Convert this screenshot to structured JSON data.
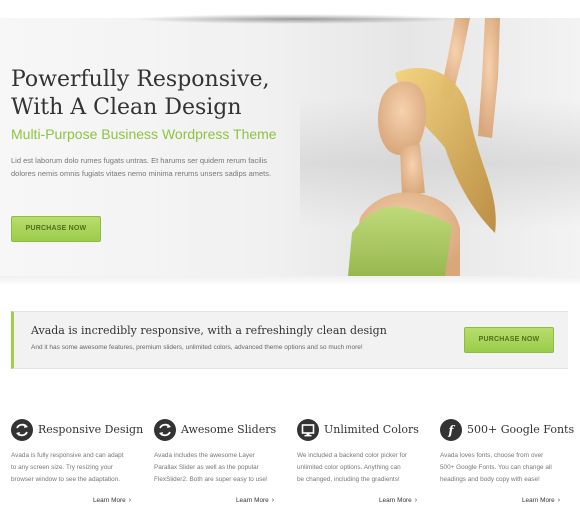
{
  "hero": {
    "title_line1": "Powerfully Responsive,",
    "title_line2": "With A Clean Design",
    "subtitle": "Multi-Purpose Business Wordpress Theme",
    "text_line1": "Lid est laborum dolo rumes fugats untras. Et harums ser quidem rerum facilis",
    "text_line2": "dolores nemis omnis fugiats vitaes nemo minima rerums unsers sadips amets.",
    "button": "PURCHASE NOW"
  },
  "reading_box": {
    "title": "Avada is incredibly responsive, with a refreshingly clean design",
    "text": "And it has some awesome features, premium sliders, unlimited colors, advanced theme options and so much more!",
    "button": "PURCHASE NOW"
  },
  "features": [
    {
      "icon": "refresh-icon",
      "title": "Responsive Design",
      "lines": [
        "Avada is fully responsive and can adapt",
        "to any screen size. Try resizing your",
        "browser window to see the adaptation."
      ],
      "link": "Learn More"
    },
    {
      "icon": "refresh-icon",
      "title": "Awesome Sliders",
      "lines": [
        "Avada includes the awesome Layer",
        "Parallax Slider as well as the popular",
        "FlexSlider2. Both are super easy to use!"
      ],
      "link": "Learn More"
    },
    {
      "icon": "monitor-icon",
      "title": "Unlimited Colors",
      "lines": [
        "We included a backend color picker for",
        "unlimited color options. Anything can",
        "be changed, including the gradients!"
      ],
      "link": "Learn More"
    },
    {
      "icon": "font-icon",
      "title": "500+ Google Fonts",
      "lines": [
        "Avada loves fonts, choose from over",
        "500+ Google Fonts. You can change all",
        "headings and body copy with ease!"
      ],
      "link": "Learn More"
    }
  ],
  "colors": {
    "accent": "#a0ce4e",
    "accent_text": "#8cc43f",
    "heading": "#333333",
    "body": "#777777"
  }
}
